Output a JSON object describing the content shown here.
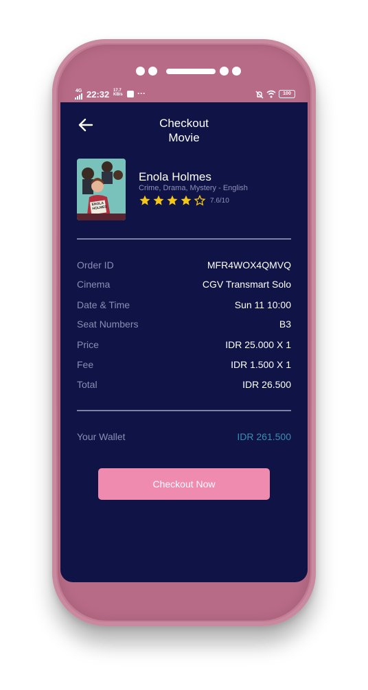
{
  "status_bar": {
    "network": "4G",
    "time": "22:32",
    "speed": "17.7 KB/s",
    "battery": "100",
    "more": "···"
  },
  "header": {
    "title_line1": "Checkout",
    "title_line2": "Movie"
  },
  "movie": {
    "title": "Enola Holmes",
    "genre": "Crime, Drama, Mystery - English",
    "rating_stars": 4,
    "rating_max_stars": 5,
    "rating_text": "7.6/10",
    "poster_caption": "ENOLA HOLMES"
  },
  "details": [
    {
      "label": "Order ID",
      "value": "MFR4WOX4QMVQ"
    },
    {
      "label": "Cinema",
      "value": "CGV Transmart Solo"
    },
    {
      "label": "Date & Time",
      "value": "Sun 11 10:00"
    },
    {
      "label": "Seat Numbers",
      "value": "B3"
    },
    {
      "label": "Price",
      "value": "IDR 25.000 X 1"
    },
    {
      "label": "Fee",
      "value": "IDR 1.500 X 1"
    },
    {
      "label": "Total",
      "value": "IDR 26.500"
    }
  ],
  "wallet": {
    "label": "Your Wallet",
    "value": "IDR 261.500"
  },
  "actions": {
    "checkout_label": "Checkout Now"
  },
  "colors": {
    "screen_bg": "#101345",
    "accent_button": "#f08bb0",
    "wallet_value": "#3b8fb0",
    "star": "#f5c518",
    "phone_body": "#b96f88"
  }
}
